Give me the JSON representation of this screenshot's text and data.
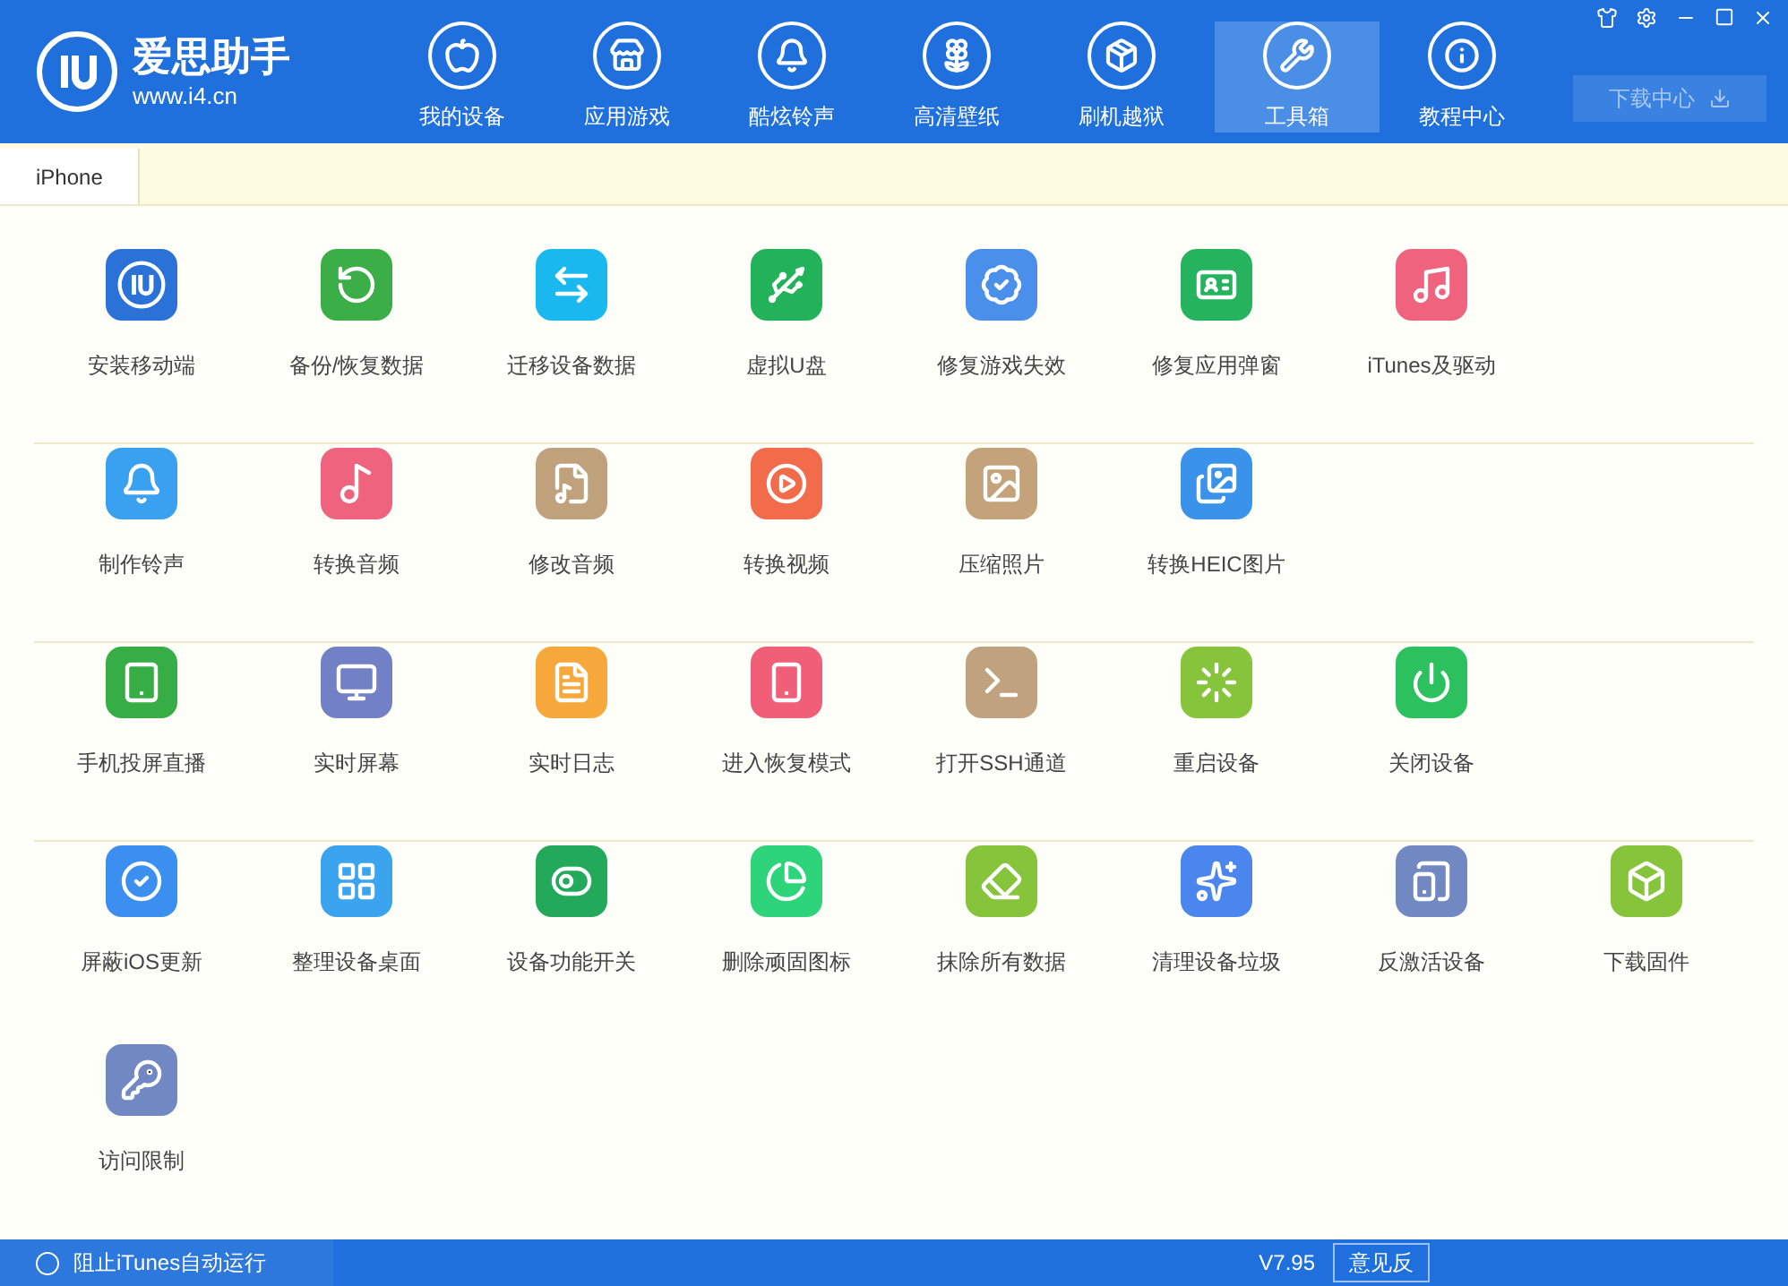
{
  "logo": {
    "name": "爱思助手",
    "url": "www.i4.cn"
  },
  "nav": [
    {
      "label": "我的设备",
      "selected": false
    },
    {
      "label": "应用游戏",
      "selected": false
    },
    {
      "label": "酷炫铃声",
      "selected": false
    },
    {
      "label": "高清壁纸",
      "selected": false
    },
    {
      "label": "刷机越狱",
      "selected": false
    },
    {
      "label": "工具箱",
      "selected": true
    },
    {
      "label": "教程中心",
      "selected": false
    }
  ],
  "download_button": {
    "label": "下载中心",
    "disabled": true
  },
  "tabs": [
    {
      "label": "iPhone",
      "selected": true
    }
  ],
  "tool_rows": [
    [
      {
        "label": "安装移动端",
        "color": "#2a72d8"
      },
      {
        "label": "备份/恢复数据",
        "color": "#3cae48"
      },
      {
        "label": "迁移设备数据",
        "color": "#19b9ef"
      },
      {
        "label": "虚拟U盘",
        "color": "#22b25a"
      },
      {
        "label": "修复游戏失效",
        "color": "#4a90ea"
      },
      {
        "label": "修复应用弹窗",
        "color": "#25b35e"
      },
      {
        "label": "iTunes及驱动",
        "color": "#f0637e"
      }
    ],
    [
      {
        "label": "制作铃声",
        "color": "#3aa0f0"
      },
      {
        "label": "转换音频",
        "color": "#f0637e"
      },
      {
        "label": "修改音频",
        "color": "#bfa27c"
      },
      {
        "label": "转换视频",
        "color": "#f26b4b"
      },
      {
        "label": "压缩照片",
        "color": "#c4a27a"
      },
      {
        "label": "转换HEIC图片",
        "color": "#3a92ea"
      }
    ],
    [
      {
        "label": "手机投屏直播",
        "color": "#37ad45"
      },
      {
        "label": "实时屏幕",
        "color": "#7280c6"
      },
      {
        "label": "实时日志",
        "color": "#f6a93a"
      },
      {
        "label": "进入恢复模式",
        "color": "#f05e78"
      },
      {
        "label": "打开SSH通道",
        "color": "#c0a37e"
      },
      {
        "label": "重启设备",
        "color": "#86c43c"
      },
      {
        "label": "关闭设备",
        "color": "#2cc05e"
      }
    ],
    [
      {
        "label": "屏蔽iOS更新",
        "color": "#3a8ff0"
      },
      {
        "label": "整理设备桌面",
        "color": "#3aa4ee"
      },
      {
        "label": "设备功能开关",
        "color": "#22aa5a"
      },
      {
        "label": "删除顽固图标",
        "color": "#2ed47a"
      },
      {
        "label": "抹除所有数据",
        "color": "#86c43c"
      },
      {
        "label": "清理设备垃圾",
        "color": "#4a86ee"
      },
      {
        "label": "反激活设备",
        "color": "#7288c2"
      },
      {
        "label": "下载固件",
        "color": "#86c43c"
      },
      {
        "label": "访问限制",
        "color": "#7288c2"
      }
    ]
  ],
  "footer": {
    "itunes_block": {
      "label": "阻止iTunes自动运行",
      "checked": false
    },
    "version": "V7.95",
    "feedback_button": "意见反"
  }
}
